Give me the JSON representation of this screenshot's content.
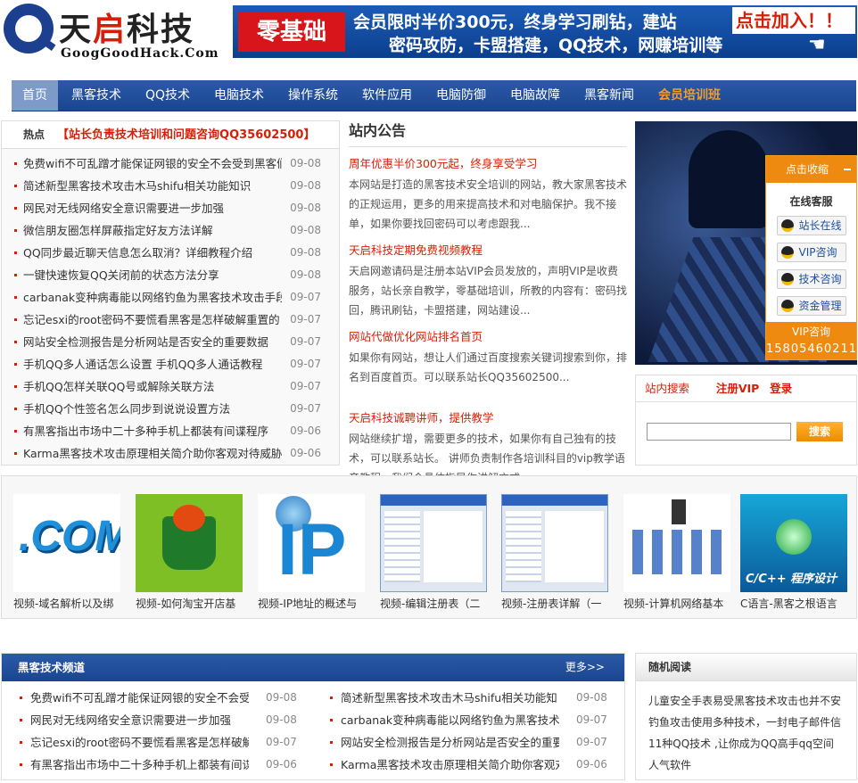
{
  "logo": {
    "name_a": "天",
    "name_hi": "启",
    "name_b": "科技",
    "domain": "GoogGoodHack.Com"
  },
  "banner": {
    "zero": "零基础",
    "line1": "会员限时半价300元，终身学习刷钻，建站",
    "line2": "密码攻防，卡盟搭建，QQ技术，网赚培训等",
    "join": "点击加入！！"
  },
  "nav": [
    "首页",
    "黑客技术",
    "QQ技术",
    "电脑技术",
    "操作系统",
    "软件应用",
    "电脑防御",
    "电脑故障",
    "黑客新闻",
    "会员培训班"
  ],
  "hot": {
    "label": "热点",
    "headline": "【站长负责技术培训和问题咨询QQ35602500】",
    "items": [
      {
        "t": "免费wifi不可乱蹭才能保证网银的安全不会受到黑客们",
        "d": "09-08"
      },
      {
        "t": "简述新型黑客技术攻击木马shifu相关功能知识",
        "d": "09-08"
      },
      {
        "t": "网民对无线网络安全意识需要进一步加强",
        "d": "09-08"
      },
      {
        "t": "微信朋友圈怎样屏蔽指定好友方法详解",
        "d": "09-08"
      },
      {
        "t": "QQ同步最近聊天信息怎么取消？详细教程介绍",
        "d": "09-08"
      },
      {
        "t": "一键快速恢复QQ关闭前的状态方法分享",
        "d": "09-08"
      },
      {
        "t": "carbanak变种病毒能以网络钓鱼为黑客技术攻击手段",
        "d": "09-07"
      },
      {
        "t": "忘记esxi的root密码不要慌看黑客是怎样破解重置的",
        "d": "09-07"
      },
      {
        "t": "网站安全检测报告是分析网站是否安全的重要数据",
        "d": "09-07"
      },
      {
        "t": "手机QQ多人通话怎么设置 手机QQ多人通话教程",
        "d": "09-07"
      },
      {
        "t": "手机QQ怎样关联QQ号或解除关联方法",
        "d": "09-07"
      },
      {
        "t": "手机QQ个性签名怎么同步到说说设置方法",
        "d": "09-07"
      },
      {
        "t": "有黑客指出市场中二十多种手机上都装有间谍程序",
        "d": "09-06"
      },
      {
        "t": "Karma黑客技术攻击原理相关简介助你客观对待威胁",
        "d": "09-06"
      }
    ]
  },
  "notice": {
    "title": "站内公告",
    "items": [
      {
        "h": "周年优惠半价300元起，终身享受学习",
        "p": "本网站是打造的黑客技术安全培训的网站，教大家黑客技术的正规运用，更多的用来提高技术和对电脑保护。我不接单，如果你要找回密码可以考虑跟我..."
      },
      {
        "h": "天启科技定期免费视频教程",
        "p": "天启网邀请码是注册本站VIP会员发放的，声明VIP是收费服务，站长亲自教学，零基础培训，所教的内容有：密码找回，腾讯刷钻，卡盟搭建，网站建设..."
      },
      {
        "h": "网站代做优化网站排名首页",
        "p": "如果你有网站，想让人们通过百度搜索关键词搜索到你，排名到百度首页。可以联系站长QQ35602500..."
      },
      {
        "h": "天启科技诚聘讲师，提供教学",
        "p": "网站继续扩增，需要更多的技术，如果你有自己独有的技术，可以联系站长。 讲师负责制作各培训科目的vip教学语音教程，我们会具体指导你讲解方式..."
      }
    ]
  },
  "service": {
    "top": "点击收缩",
    "label": "在线客服",
    "buttons": [
      "站长在线",
      "VIP咨询",
      "技术咨询",
      "资金管理"
    ],
    "vip": "VIP咨询",
    "phone": "15805460211"
  },
  "search": {
    "tab": "站内搜索",
    "register": "注册VIP",
    "login": "登录",
    "button": "搜索",
    "value": ""
  },
  "videos": [
    {
      "cap": "视频-域名解析以及绑"
    },
    {
      "cap": "视频-如何淘宝开店基"
    },
    {
      "cap": "视频-IP地址的概述与"
    },
    {
      "cap": "视频-编辑注册表（二"
    },
    {
      "cap": "视频-注册表详解（一"
    },
    {
      "cap": "视频-计算机网络基本"
    },
    {
      "cap": "C语言-黑客之根语言"
    }
  ],
  "video_art": {
    "com": ".COM",
    "ip": "IP",
    "cpp": "C/C++ 程序设计"
  },
  "channel": {
    "title": "黑客技术频道",
    "more": "更多>>",
    "left": [
      {
        "t": "免费wifi不可乱蹭才能保证网银的安全不会受",
        "d": "09-08"
      },
      {
        "t": "网民对无线网络安全意识需要进一步加强",
        "d": "09-08"
      },
      {
        "t": "忘记esxi的root密码不要慌看黑客是怎样破解",
        "d": "09-07"
      },
      {
        "t": "有黑客指出市场中二十多种手机上都装有间谍",
        "d": "09-06"
      }
    ],
    "right": [
      {
        "t": "简述新型黑客技术攻击木马shifu相关功能知",
        "d": "09-08"
      },
      {
        "t": "carbanak变种病毒能以网络钓鱼为黑客技术攻",
        "d": "09-07"
      },
      {
        "t": "网站安全检测报告是分析网站是否安全的重要",
        "d": "09-07"
      },
      {
        "t": "Karma黑客技术攻击原理相关简介助你客观对",
        "d": "09-06"
      }
    ]
  },
  "random": {
    "title": "随机阅读",
    "text": "儿童安全手表易受黑客技术攻击也并不安钓鱼攻击使用多种技术，一封电子邮件信11种QQ技术 ,让你成为QQ高手qq空间人气软件"
  }
}
